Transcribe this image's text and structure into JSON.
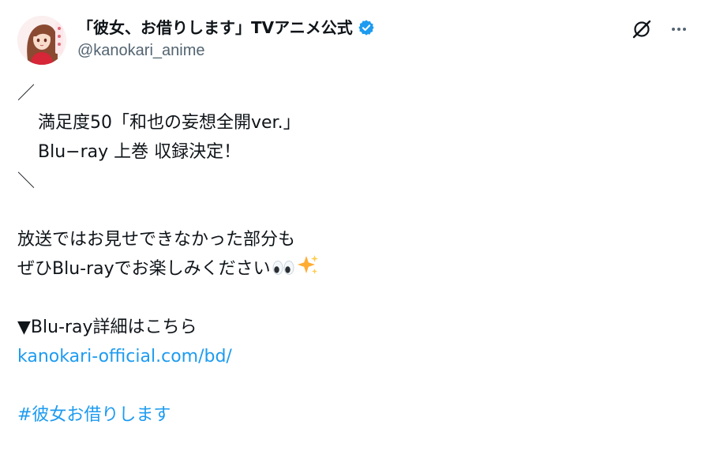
{
  "author": {
    "display_name": "「彼女、お借りします」TVアニメ公式",
    "handle": "@kanokari_anime",
    "verified_color": "#1d9bf0"
  },
  "icons": {
    "avatar": "avatar-image",
    "verified": "verified-badge-icon",
    "grok": "grok-icon",
    "more": "more-options-icon"
  },
  "tweet": {
    "line_open": "／",
    "line_title": "満足度50「和也の妄想全開ver.」",
    "line_bluray": "Blu−ray 上巻 収録決定！",
    "line_close": "＼",
    "line_body1": "放送ではお見せできなかった部分も",
    "line_body2": "ぜひBlu-rayでお楽しみください",
    "emoji_eyes": "👀",
    "emoji_sparkles": "✨",
    "details_label": "▼Blu-ray詳細はこちら",
    "link": "kanokari-official.com/bd/",
    "hashtag": "#彼女お借りします"
  },
  "colors": {
    "text": "#0f1419",
    "secondary": "#536471",
    "link": "#1d9bf0"
  }
}
